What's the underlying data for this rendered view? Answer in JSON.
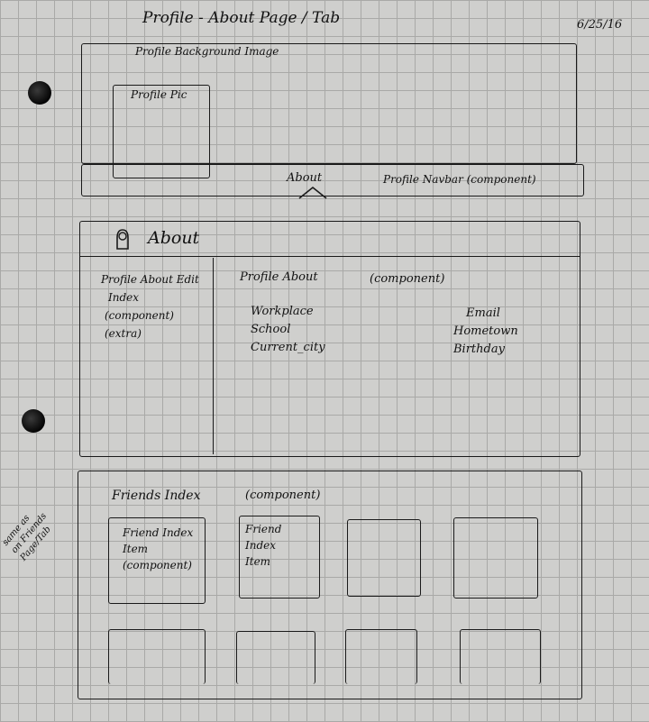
{
  "header": {
    "title": "Profile - About Page / Tab",
    "date": "6/25/16"
  },
  "hero": {
    "background_label": "Profile Background Image",
    "pic_label": "Profile Pic",
    "navbar_about": "About",
    "navbar_label": "Profile Navbar (component)"
  },
  "about": {
    "heading": "About",
    "edit_index": [
      "Profile About Edit",
      "Index",
      "(component)",
      "(extra)"
    ],
    "about_title": "Profile About",
    "about_component": "(component)",
    "fields_left": [
      "Workplace",
      "School",
      "Current_city"
    ],
    "fields_right": [
      "Email",
      "Hometown",
      "Birthday"
    ]
  },
  "friends": {
    "title": "Friends Index",
    "component": "(component)",
    "item1": [
      "Friend Index",
      "Item",
      "(component)"
    ],
    "item2": [
      "Friend",
      "Index",
      "Item"
    ]
  },
  "side_note": [
    "same as",
    "on Friends",
    "Page/Tab"
  ]
}
